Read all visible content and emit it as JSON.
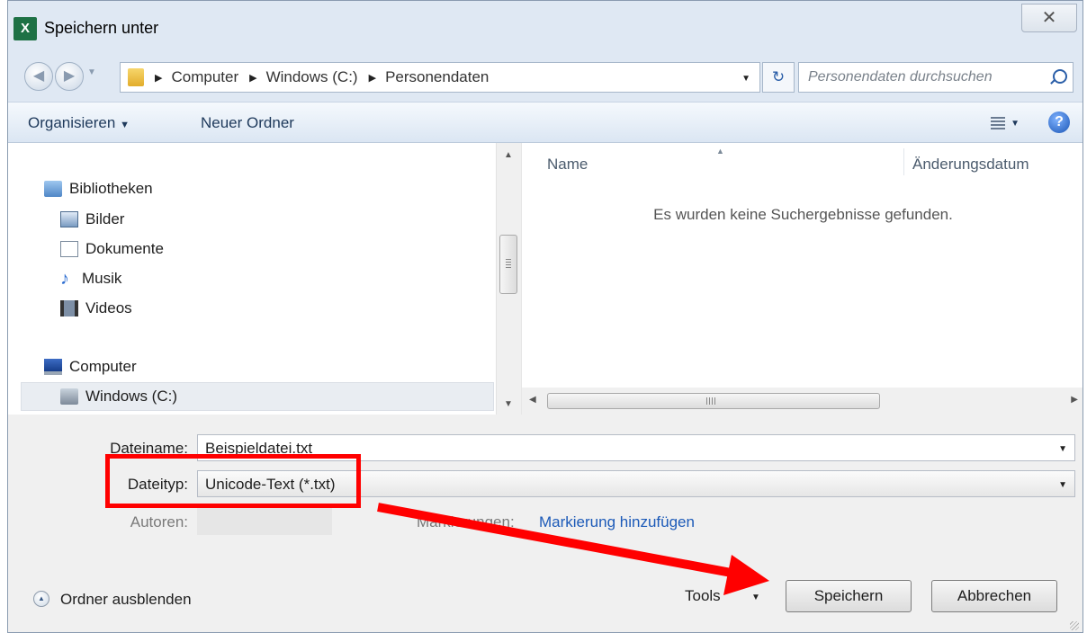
{
  "window": {
    "title": "Speichern unter",
    "app_icon": "X",
    "close_symbol": "✕"
  },
  "nav": {
    "breadcrumbs": [
      "Computer",
      "Windows (C:)",
      "Personendaten"
    ],
    "search_placeholder": "Personendaten durchsuchen"
  },
  "toolbar": {
    "organize": "Organisieren",
    "new_folder": "Neuer Ordner",
    "help_symbol": "?"
  },
  "sidebar": {
    "libraries": "Bibliotheken",
    "items": [
      "Bilder",
      "Dokumente",
      "Musik",
      "Videos"
    ],
    "computer": "Computer",
    "drive": "Windows (C:)"
  },
  "files": {
    "columns": [
      "Name",
      "Änderungsdatum"
    ],
    "empty_message": "Es wurden keine Suchergebnisse gefunden."
  },
  "form": {
    "filename_label": "Dateiname:",
    "filename_value": "Beispieldatei.txt",
    "filetype_label": "Dateityp:",
    "filetype_value": "Unicode-Text (*.txt)",
    "authors_label": "Autoren:",
    "tags_label": "Markierungen:",
    "tags_link": "Markierung hinzufügen"
  },
  "footer": {
    "hide_folders": "Ordner ausblenden",
    "tools": "Tools",
    "save": "Speichern",
    "cancel": "Abbrechen"
  },
  "colors": {
    "annotation_red": "#ff0000",
    "link_blue": "#1c5ab8"
  }
}
